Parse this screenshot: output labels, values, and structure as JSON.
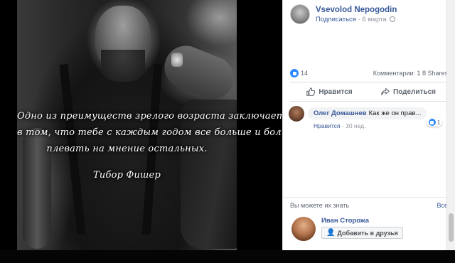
{
  "quote": {
    "lines": [
      "Одно из преимуществ зрелого возраста заключается",
      "в том, что тебе с каждым годом все больше и больше",
      "плевать на мнение остальных."
    ],
    "author": "Тибор Фишер"
  },
  "post": {
    "author": "Vsevolod Nepogodin",
    "follow": "Подписаться",
    "dot": "·",
    "date": "6 марта",
    "likes": "14",
    "comments_label": "Комментарии: 1",
    "shares_label": "8 Shares",
    "like_action": "Нравится",
    "share_action": "Поделиться"
  },
  "comment": {
    "author": "Олег Домашнев",
    "text": "Как же он прав...",
    "reactions": "1",
    "like_link": "Нравится",
    "dot": "·",
    "age": "30 нед."
  },
  "pymk": {
    "title": "Вы можете их знать",
    "see_all": "Все",
    "person_name": "Иван Сторожа",
    "add_button": "Добавить в друзья",
    "close": "×"
  },
  "colors": {
    "link": "#385898",
    "like_blue": "#2d88ff",
    "muted": "#90949c"
  }
}
